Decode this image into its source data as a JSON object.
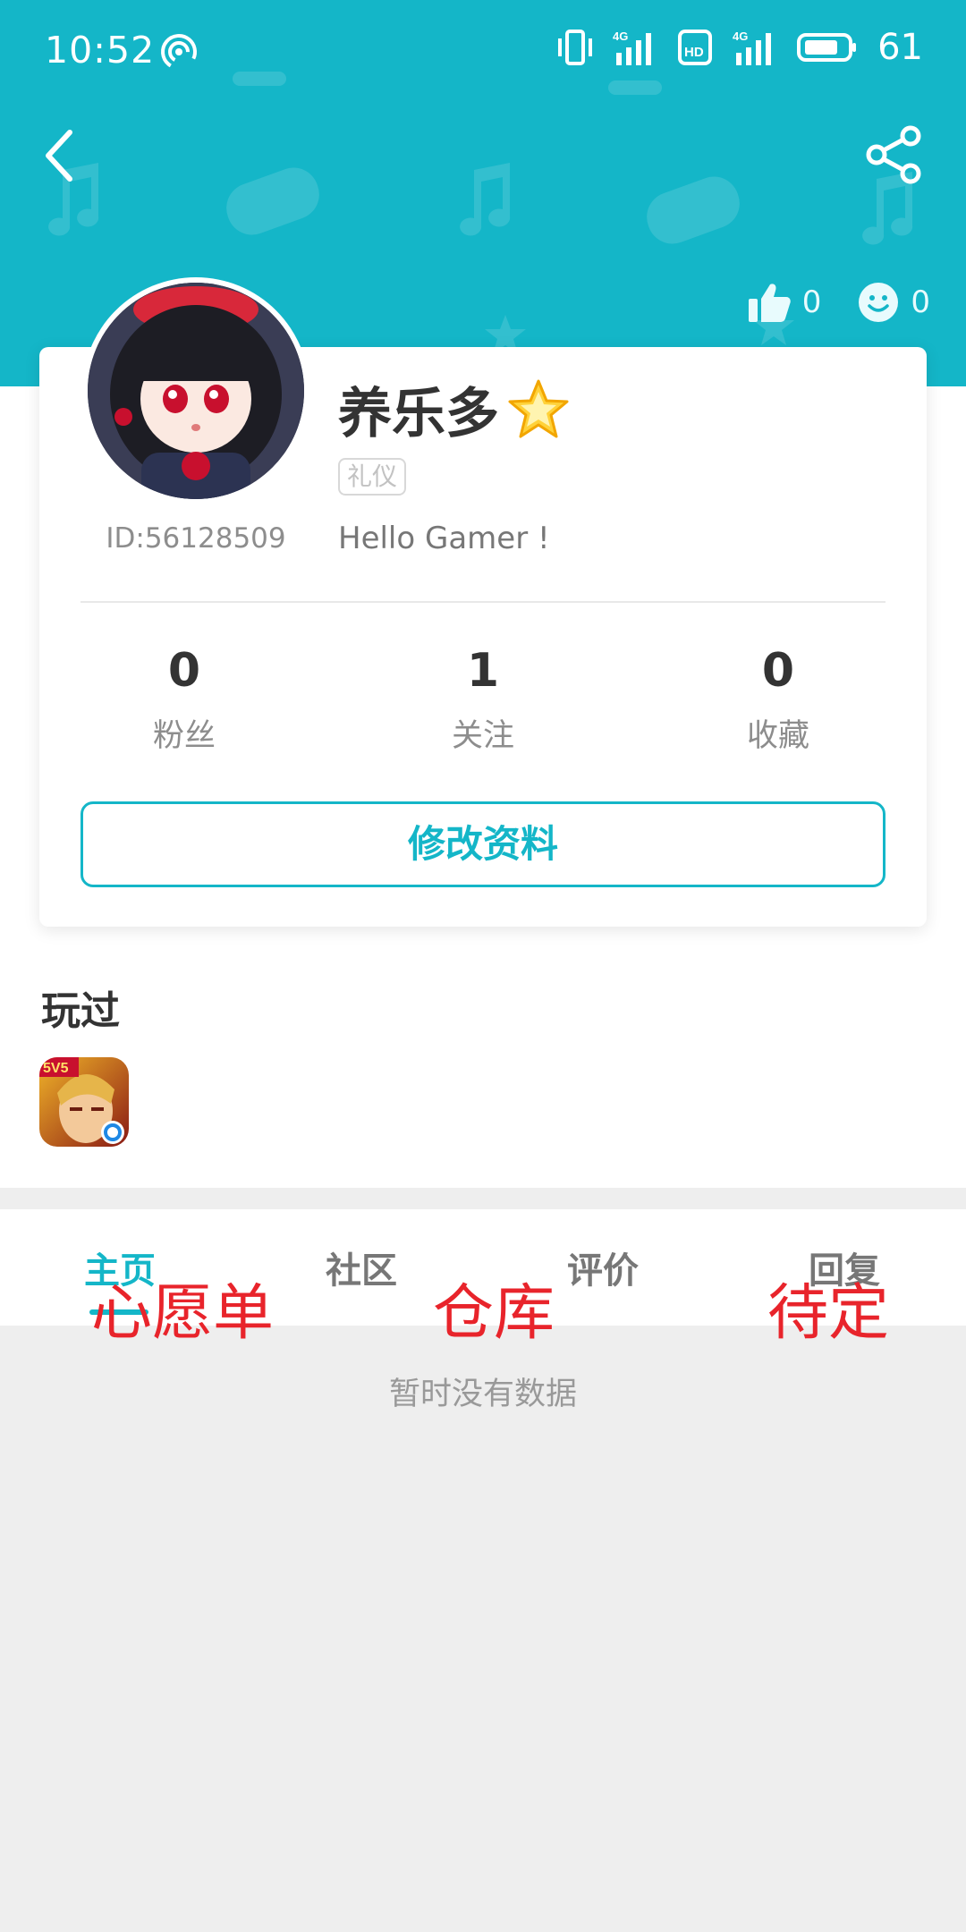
{
  "status_bar": {
    "time": "10:52",
    "battery": "61",
    "network_1": "4G",
    "network_2": "4G"
  },
  "header": {
    "back_icon": "chevron-left-icon",
    "share_icon": "share-icon",
    "likes": "0",
    "smiles": "0"
  },
  "profile": {
    "name": "养乐多",
    "tag": "礼仪",
    "bio": "Hello Gamer !",
    "id": "ID:56128509",
    "badge_icon": "star-icon"
  },
  "stats": [
    {
      "value": "0",
      "label": "粉丝"
    },
    {
      "value": "1",
      "label": "关注"
    },
    {
      "value": "0",
      "label": "收藏"
    }
  ],
  "edit_button": "修改资料",
  "played": {
    "title": "玩过",
    "game_badge": "5V5"
  },
  "tabs": [
    {
      "label": "主页",
      "active": true
    },
    {
      "label": "社区",
      "active": false
    },
    {
      "label": "评价",
      "active": false
    },
    {
      "label": "回复",
      "active": false
    }
  ],
  "overlay_labels": [
    "心愿单",
    "仓库",
    "待定"
  ],
  "empty_message": "暂时没有数据",
  "colors": {
    "accent": "#14b6c8",
    "overlay_red": "#e8242b",
    "background": "#eeeeee"
  }
}
